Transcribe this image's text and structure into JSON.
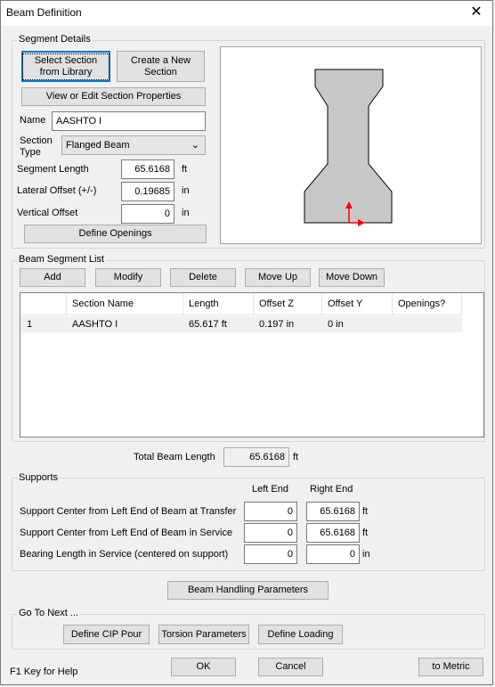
{
  "window": {
    "title": "Beam Definition",
    "close": "✕"
  },
  "segment": {
    "legend": "Segment Details",
    "select_library": "Select Section from Library",
    "create_new": "Create a New Section",
    "view_edit": "View or Edit Section Properties",
    "name_label": "Name",
    "name_value": "AASHTO I",
    "type_label": "Section Type",
    "type_value": "Flanged Beam",
    "length_label": "Segment Length",
    "length_value": "65.6168",
    "length_unit": "ft",
    "lateral_label": "Lateral Offset (+/-)",
    "lateral_value": "0.19685",
    "lateral_unit": "in",
    "vertical_label": "Vertical Offset",
    "vertical_value": "0",
    "vertical_unit": "in",
    "define_openings": "Define Openings"
  },
  "list": {
    "legend": "Beam Segment List",
    "buttons": {
      "add": "Add",
      "modify": "Modify",
      "delete": "Delete",
      "up": "Move Up",
      "down": "Move Down"
    },
    "headers": [
      "",
      "Section Name",
      "Length",
      "Offset Z",
      "Offset Y",
      "Openings?"
    ],
    "rows": [
      [
        "1",
        "AASHTO I",
        "65.617 ft",
        "0.197 in",
        "0 in",
        ""
      ]
    ]
  },
  "total": {
    "label": "Total Beam Length",
    "value": "65.6168",
    "unit": "ft"
  },
  "supports": {
    "legend": "Supports",
    "left_end": "Left End",
    "right_end": "Right End",
    "rows": [
      {
        "label": "Support Center from Left End of Beam at Transfer",
        "left": "0",
        "right": "65.6168",
        "unit": "ft"
      },
      {
        "label": "Support Center from Left End of Beam in Service",
        "left": "0",
        "right": "65.6168",
        "unit": "ft"
      },
      {
        "label": "Bearing Length in Service (centered on support)",
        "left": "0",
        "right": "0",
        "unit": "in"
      }
    ]
  },
  "handling": "Beam Handling Parameters",
  "goto": {
    "legend": "Go To Next ...",
    "cip": "Define CIP Pour",
    "torsion": "Torsion Parameters",
    "loading": "Define Loading"
  },
  "footer": {
    "help": "F1 Key for Help",
    "ok": "OK",
    "cancel": "Cancel",
    "metric": "to Metric"
  },
  "colors": {
    "section_fill": "#c8c8c8",
    "axis": "#ff0000"
  }
}
